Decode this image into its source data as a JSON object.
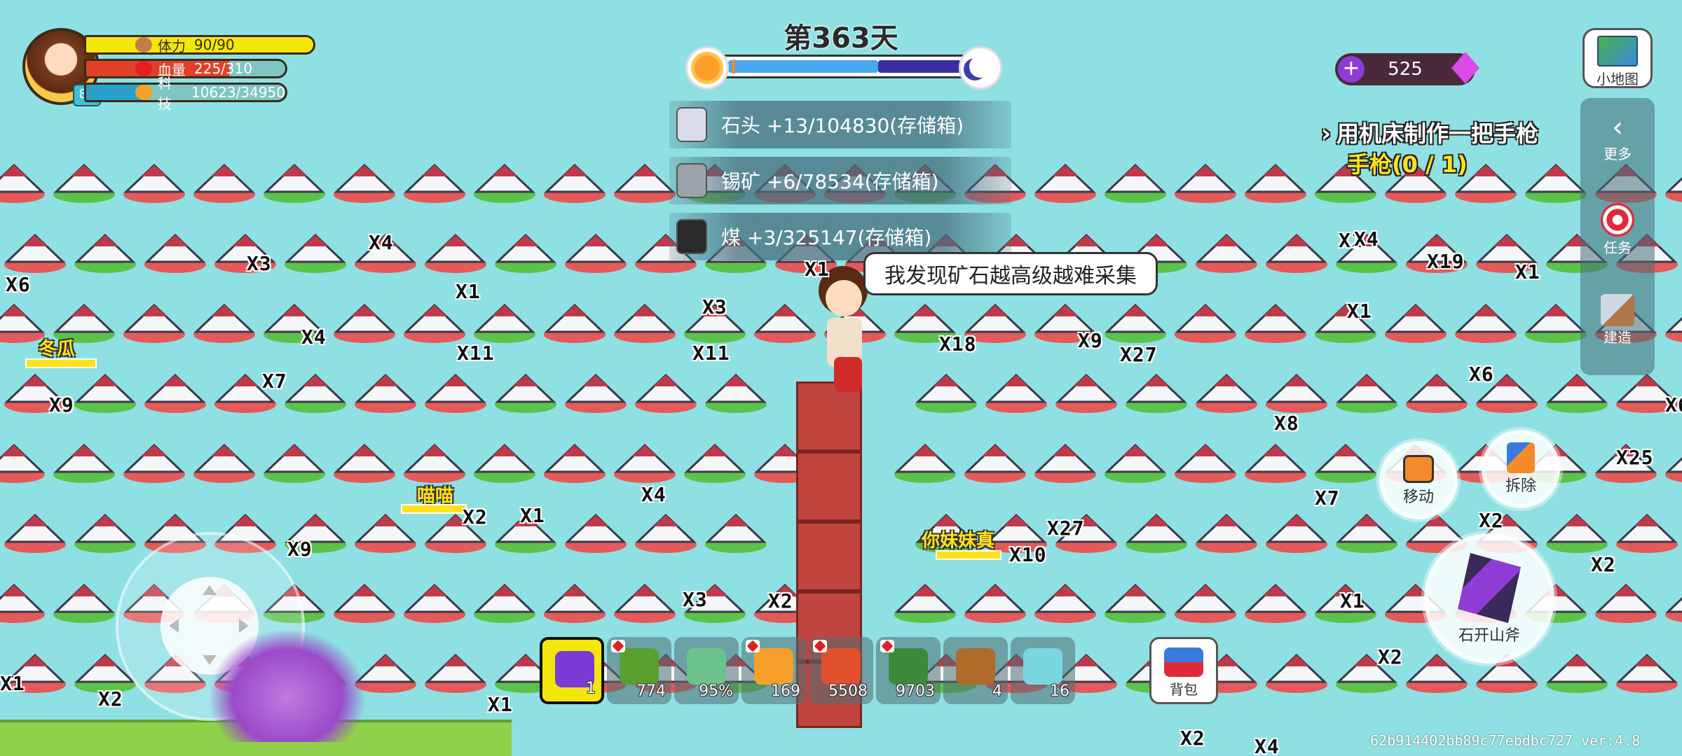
{
  "player": {
    "level": "82",
    "stamina_label": "体力",
    "stamina_value": "90/90",
    "hp_label": "血量",
    "hp_value": "225/310",
    "tech_label": "科技",
    "tech_value": "10623/34950",
    "stamina_fraction": 1.0,
    "hp_fraction": 0.726,
    "tech_fraction": 0.304
  },
  "day": {
    "title": "第363天",
    "progress_fraction": 0.62
  },
  "currency": {
    "gems": "525"
  },
  "minimap": {
    "label": "小地图"
  },
  "side_menu": {
    "more_label": "更多",
    "task_label": "任务",
    "build_label": "建造"
  },
  "resource_toasts": [
    {
      "icon": "stone-icon",
      "text": "石头  +13/104830(存储箱)"
    },
    {
      "icon": "tin-ore-icon",
      "text": "锡矿  +6/78534(存储箱)"
    },
    {
      "icon": "coal-icon",
      "text": "煤  +3/325147(存储箱)"
    }
  ],
  "quest": {
    "title": "用机床制作一把手枪",
    "progress": "手枪(0 / 1)"
  },
  "speech": {
    "text": "我发现矿石越高级越难采集"
  },
  "actions": {
    "move_label": "移动",
    "demolish_label": "拆除",
    "tool_label": "石开山斧"
  },
  "hotbar": [
    {
      "icon": "axe-icon",
      "count": "1",
      "selected": true,
      "color": "#7b3bd6"
    },
    {
      "icon": "soup-bowl-icon",
      "count": "774",
      "selected": false,
      "heart": true,
      "color": "#5aa02e"
    },
    {
      "icon": "herb-icon",
      "count": "95%",
      "selected": false,
      "color": "#6bc28a"
    },
    {
      "icon": "fried-egg-icon",
      "count": "169",
      "selected": false,
      "heart": true,
      "color": "#f5a02a"
    },
    {
      "icon": "berry-icon",
      "count": "5508",
      "selected": false,
      "heart": true,
      "color": "#e0502a"
    },
    {
      "icon": "grass-bundle-icon",
      "count": "9703",
      "selected": false,
      "heart": true,
      "color": "#3b8a3a"
    },
    {
      "icon": "net-trap-icon",
      "count": "4",
      "selected": false,
      "color": "#b06a2a"
    },
    {
      "icon": "potion-bottle-icon",
      "count": "16",
      "selected": false,
      "color": "#7ad7e0"
    }
  ],
  "backpack": {
    "label": "背包"
  },
  "players_nearby": [
    {
      "name": "冬瓜"
    },
    {
      "name": "喵喵"
    },
    {
      "name": "你妹妹真"
    }
  ],
  "drops": [
    "X6",
    "X3",
    "X4",
    "X1",
    "X4",
    "X11",
    "X11",
    "X3",
    "X1",
    "X18",
    "X9",
    "X27",
    "X7",
    "X9",
    "X4",
    "X2",
    "X1",
    "X9",
    "X27",
    "X10",
    "X3",
    "X2",
    "X1",
    "X2",
    "X1",
    "X4",
    "X19",
    "X1",
    "X1",
    "X6",
    "X8",
    "X7",
    "X2",
    "X25",
    "X6",
    "X2",
    "X1",
    "X2",
    "X2",
    "X4",
    "X1"
  ],
  "version": "62b914402bb89c77ebdbc727 ver:4.8"
}
